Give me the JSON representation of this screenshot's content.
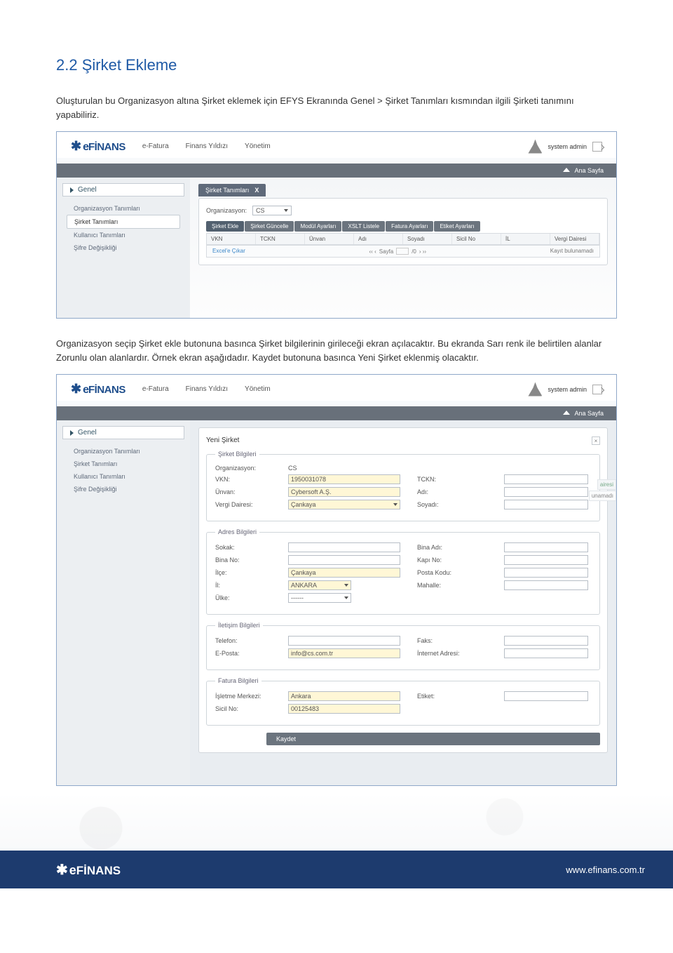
{
  "heading": "2.2 Şirket Ekleme",
  "para1": "Oluşturulan bu Organizasyon altına Şirket eklemek için EFYS Ekranında Genel > Şirket Tanımları kısmından ilgili Şirketi tanımını yapabiliriz.",
  "para2": "Organizasyon seçip Şirket ekle butonuna basınca Şirket bilgilerinin girileceği ekran açılacaktır. Bu ekranda Sarı renk ile belirtilen alanlar Zorunlu olan alanlardır. Örnek ekran aşağıdadır. Kaydet butonuna basınca Yeni Şirket eklenmiş olacaktır.",
  "logo": {
    "brand_e": "e",
    "brand_finans": "FİNANS"
  },
  "topmenu": {
    "item1": "e-Fatura",
    "item2": "Finans Yıldızı",
    "item3": "Yönetim"
  },
  "user": {
    "name": "system admin"
  },
  "breadcrumb": {
    "home": "Ana Sayfa"
  },
  "sidebar": {
    "title": "Genel",
    "items": [
      "Organizasyon Tanımları",
      "Şirket Tanımları",
      "Kullanıcı Tanımları",
      "Şifre Değişikliği"
    ]
  },
  "ss1": {
    "tab": "Şirket Tanımları",
    "org_label": "Organizasyon:",
    "org_value": "CS",
    "buttons": [
      "Şirket Ekle",
      "Şirket Güncelle",
      "Modül Ayarları",
      "XSLT Listele",
      "Fatura Ayarları",
      "Etiket Ayarları"
    ],
    "cols": [
      "VKN",
      "TCKN",
      "Ünvan",
      "Adı",
      "Soyadı",
      "Sicil No",
      "İL",
      "Vergi Dairesi"
    ],
    "footer_left": "Excel'e Çıkar",
    "footer_page": "Sayfa",
    "footer_of": "/0",
    "footer_right": "Kayıt bulunamadı"
  },
  "ss2": {
    "panel_title": "Yeni Şirket",
    "fs1": {
      "legend": "Şirket Bilgileri",
      "org_l": "Organizasyon:",
      "org_v": "CS",
      "vkn_l": "VKN:",
      "vkn_v": "1950031078",
      "tckn_l": "TCKN:",
      "unvan_l": "Ünvan:",
      "unvan_v": "Cybersoft A.Ş.",
      "adi_l": "Adı:",
      "vd_l": "Vergi Dairesi:",
      "vd_v": "Çankaya",
      "soy_l": "Soyadı:"
    },
    "fs2": {
      "legend": "Adres Bilgileri",
      "sokak_l": "Sokak:",
      "bina_adi_l": "Bina Adı:",
      "bina_no_l": "Bina No:",
      "kapi_no_l": "Kapı No:",
      "ilce_l": "İlçe:",
      "ilce_v": "Çankaya",
      "posta_l": "Posta Kodu:",
      "il_l": "İl:",
      "il_v": "ANKARA",
      "mahalle_l": "Mahalle:",
      "ulke_l": "Ülke:",
      "ulke_v": "------"
    },
    "fs3": {
      "legend": "İletişim Bilgileri",
      "tel_l": "Telefon:",
      "faks_l": "Faks:",
      "ep_l": "E-Posta:",
      "ep_v": "info@cs.com.tr",
      "web_l": "İnternet Adresi:"
    },
    "fs4": {
      "legend": "Fatura Bilgileri",
      "im_l": "İşletme Merkezi:",
      "im_v": "Ankara",
      "et_l": "Etiket:",
      "sicil_l": "Sicil No:",
      "sicil_v": "00125483"
    },
    "save": "Kaydet",
    "side_cut1": "airesi",
    "side_cut2": "unamadı"
  },
  "footer": {
    "url": "www.efinans.com.tr"
  }
}
